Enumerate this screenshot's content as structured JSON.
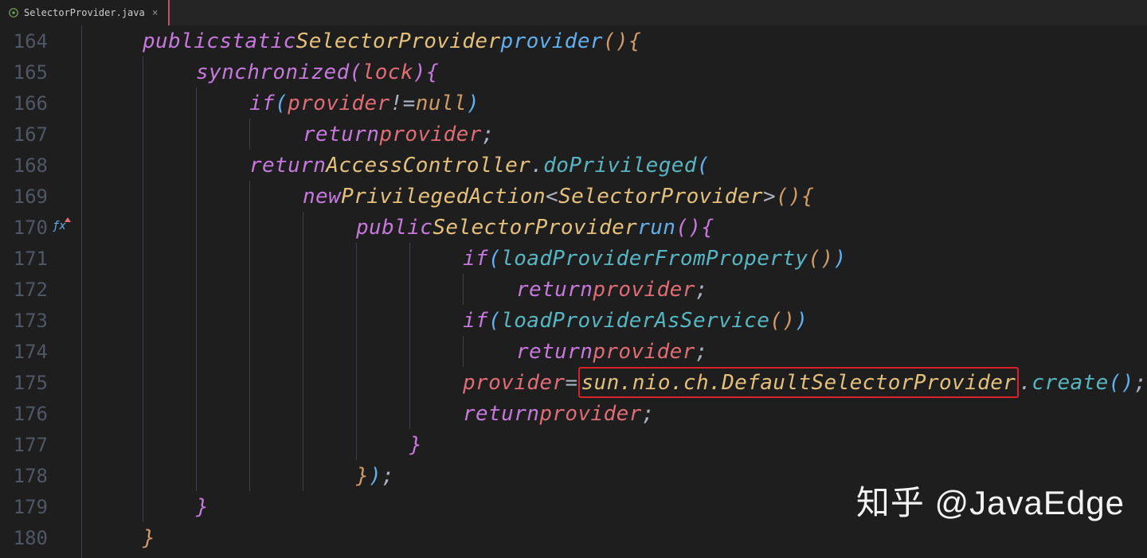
{
  "tab": {
    "filename": "SelectorProvider.java",
    "close": "×"
  },
  "line_numbers": [
    "164",
    "165",
    "166",
    "167",
    "168",
    "169",
    "170",
    "171",
    "172",
    "173",
    "174",
    "175",
    "176",
    "177",
    "178",
    "179",
    "180"
  ],
  "code": {
    "l164": {
      "kw1": "public",
      "kw2": "static",
      "type": "SelectorProvider",
      "fn": "provider",
      "paren": "()",
      "brace": "{"
    },
    "l165": {
      "kw": "synchronized",
      "lp": "(",
      "var": "lock",
      "rp": ")",
      "brace": "{"
    },
    "l166": {
      "kw": "if",
      "lp": "(",
      "var": "provider",
      "op": "!=",
      "null": "null",
      "rp": ")"
    },
    "l167": {
      "kw": "return",
      "var": "provider",
      "semi": ";"
    },
    "l168": {
      "kw": "return",
      "type": "AccessController",
      "dot": ".",
      "fn": "doPrivileged",
      "lp": "("
    },
    "l169": {
      "kw": "new",
      "type": "PrivilegedAction",
      "lt": "<",
      "gtype": "SelectorProvider",
      "gt": ">",
      "paren": "()",
      "brace": "{"
    },
    "l170": {
      "kw": "public",
      "type": "SelectorProvider",
      "fn": "run",
      "paren": "()",
      "brace": "{"
    },
    "l171": {
      "kw": "if",
      "lp": "(",
      "fn": "loadProviderFromProperty",
      "paren": "()",
      "rp": ")"
    },
    "l172": {
      "kw": "return",
      "var": "provider",
      "semi": ";"
    },
    "l173": {
      "kw": "if",
      "lp": "(",
      "fn": "loadProviderAsService",
      "paren": "()",
      "rp": ")"
    },
    "l174": {
      "kw": "return",
      "var": "provider",
      "semi": ";"
    },
    "l175": {
      "var": "provider",
      "eq": "=",
      "hl": "sun.nio.ch.DefaultSelectorProvider",
      "dot": ".",
      "fn": "create",
      "paren": "()",
      "semi": ";"
    },
    "l176": {
      "kw": "return",
      "var": "provider",
      "semi": ";"
    },
    "l177": {
      "brace": "}"
    },
    "l178": {
      "brace": "}",
      "rp": ")",
      "semi": ";"
    },
    "l179": {
      "brace": "}"
    },
    "l180": {
      "brace": "}"
    }
  },
  "glyph": {
    "fx": "ƒx"
  },
  "watermark": "知乎 @JavaEdge"
}
